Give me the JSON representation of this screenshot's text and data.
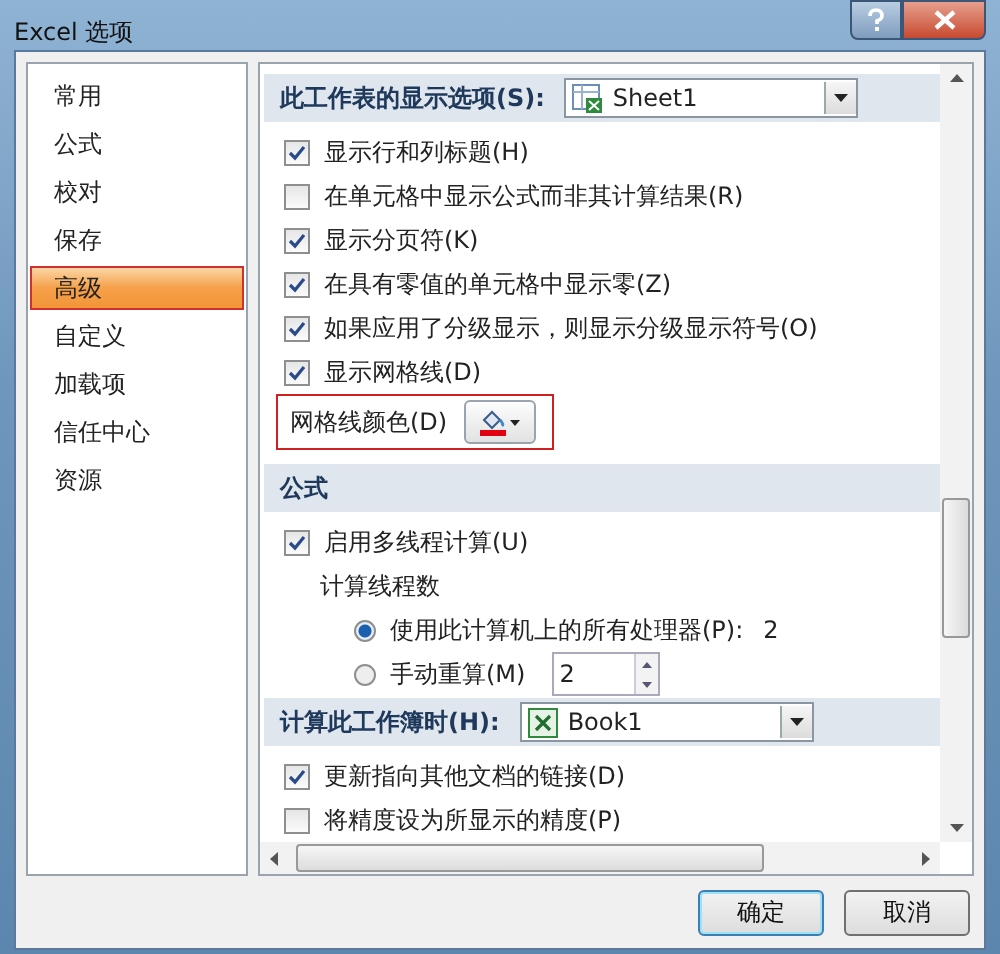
{
  "window": {
    "title": "Excel 选项"
  },
  "sidebar": {
    "items": [
      {
        "label": "常用",
        "selected": false
      },
      {
        "label": "公式",
        "selected": false
      },
      {
        "label": "校对",
        "selected": false
      },
      {
        "label": "保存",
        "selected": false
      },
      {
        "label": "高级",
        "selected": true
      },
      {
        "label": "自定义",
        "selected": false
      },
      {
        "label": "加载项",
        "selected": false
      },
      {
        "label": "信任中心",
        "selected": false
      },
      {
        "label": "资源",
        "selected": false
      }
    ]
  },
  "rows": [
    {
      "kind": "section",
      "label": "此工作表的显示选项(S):",
      "dropdown": {
        "kind": "sheet",
        "value": "Sheet1"
      }
    },
    {
      "kind": "checkbox",
      "label": "显示行和列标题(H)",
      "checked": true
    },
    {
      "kind": "checkbox",
      "label": "在单元格中显示公式而非其计算结果(R)",
      "checked": false
    },
    {
      "kind": "checkbox",
      "label": "显示分页符(K)",
      "checked": true
    },
    {
      "kind": "checkbox",
      "label": "在具有零值的单元格中显示零(Z)",
      "checked": true
    },
    {
      "kind": "checkbox",
      "label": "如果应用了分级显示，则显示分级显示符号(O)",
      "checked": true
    },
    {
      "kind": "checkbox",
      "label": "显示网格线(D)",
      "checked": true
    },
    {
      "kind": "color",
      "label": "网格线颜色(D)",
      "highlighted": true
    },
    {
      "kind": "section",
      "label": "公式"
    },
    {
      "kind": "checkbox",
      "label": "启用多线程计算(U)",
      "checked": true
    },
    {
      "kind": "label",
      "label": "计算线程数"
    },
    {
      "kind": "radio",
      "label": "使用此计算机上的所有处理器(P):",
      "selected": true,
      "value": "2"
    },
    {
      "kind": "radio",
      "label": "手动重算(M)",
      "selected": false,
      "spinner": "2"
    },
    {
      "kind": "section",
      "label": "计算此工作簿时(H):",
      "dropdown": {
        "kind": "workbook",
        "value": "Book1"
      }
    },
    {
      "kind": "checkbox",
      "label": "更新指向其他文档的链接(D)",
      "checked": true
    },
    {
      "kind": "checkbox",
      "label": "将精度设为所显示的精度(P)",
      "checked": false
    }
  ],
  "buttons": [
    {
      "label": "确定",
      "default": true
    },
    {
      "label": "取消",
      "default": false
    }
  ]
}
